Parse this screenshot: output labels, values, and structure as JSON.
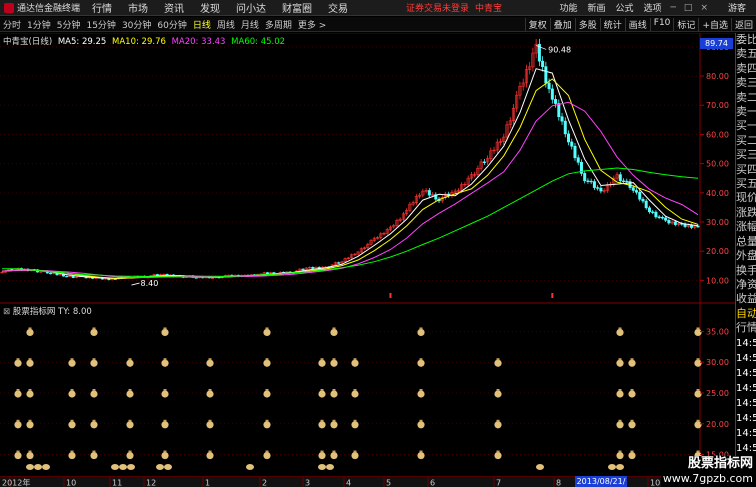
{
  "menubar": {
    "app_title": "通达信金融终端",
    "items": [
      "行情",
      "市场",
      "资讯",
      "发现",
      "问小达",
      "财富圈",
      "交易"
    ],
    "status": "证券交易未登录",
    "stock_name": "中青宝",
    "right_items": [
      "功能",
      "新画",
      "公式",
      "选项"
    ],
    "guest": "游客"
  },
  "toolbar": {
    "periods": [
      "分时",
      "1分钟",
      "5分钟",
      "15分钟",
      "30分钟",
      "60分钟",
      "日线",
      "周线",
      "月线",
      "多周期",
      "更多 >"
    ],
    "active_period": "日线",
    "tools": [
      "复权",
      "叠加",
      "多股",
      "统计",
      "画线",
      "F10",
      "标记",
      "+自选",
      "返回"
    ]
  },
  "main_legend": {
    "title": "中青宝(日线)",
    "ma5": "MA5: 29.25",
    "ma10": "MA10: 29.76",
    "ma20": "MA20: 33.43",
    "ma60": "MA60: 45.02",
    "colors": {
      "title": "#dddddd",
      "ma5": "#ffffff",
      "ma10": "#ffff00",
      "ma20": "#ff44ff",
      "ma60": "#00ff00"
    }
  },
  "sub_legend": {
    "title": "股票指标网",
    "ty": "TY: 8.00"
  },
  "price_tag": "89.74",
  "annotations": {
    "high": "90.48",
    "low": "8.40"
  },
  "main_y_ticks": [
    "90.00",
    "80.00",
    "70.00",
    "60.00",
    "50.00",
    "40.00",
    "30.00",
    "20.00",
    "10.00"
  ],
  "sub_y_ticks": [
    "35.00",
    "30.00",
    "25.00",
    "20.00",
    "15.00"
  ],
  "x_axis": {
    "labels": [
      "2012年",
      "10",
      "11",
      "12",
      "1",
      "2",
      "3",
      "4",
      "5",
      "6",
      "7",
      "8",
      "9",
      "10"
    ],
    "cursor_date": "2013/08/21/三"
  },
  "right_panel": {
    "items": [
      "委比",
      "卖五",
      "卖四",
      "卖三",
      "卖二",
      "卖一",
      "买一",
      "买二",
      "买三",
      "买四",
      "买五",
      "现价",
      "涨跌",
      "涨幅",
      "总量",
      "外盘",
      "换手",
      "净资",
      "收益"
    ],
    "auto": "自动",
    "quote": "行情",
    "times": [
      "14:5",
      "14:5",
      "14:5",
      "14:5",
      "14:5",
      "14:5",
      "14:5",
      "14:5"
    ]
  },
  "watermark": {
    "line1": "股票指标网",
    "line2": "www.7gpzb.com"
  },
  "chart_data": {
    "type": "candlestick",
    "title": "中青宝(日线)",
    "y_range": [
      5,
      92
    ],
    "y_ticks": [
      10,
      20,
      30,
      40,
      50,
      60,
      70,
      80,
      90
    ],
    "close": [
      13.2,
      13.8,
      13.5,
      12.4,
      11.6,
      11.0,
      10.8,
      10.5,
      11.2,
      11.5,
      11.8,
      11.5,
      11.0,
      11.2,
      11.4,
      11.6,
      12.2,
      12.5,
      13.0,
      14.2,
      14.5,
      16.5,
      20.0,
      24.0,
      28.0,
      34.0,
      41.0,
      38.0,
      40.0,
      46.0,
      52.0,
      60.0,
      75.0,
      90.0,
      72.0,
      58.0,
      45.0,
      40.0,
      46.0,
      41.0,
      34.0,
      30.0,
      29.0,
      28.5
    ],
    "ma60": [
      14,
      14,
      13.5,
      13,
      12.5,
      12,
      11.8,
      11.5,
      11.4,
      11.3,
      11.2,
      11.2,
      11.1,
      11.2,
      11.4,
      11.6,
      11.9,
      12.2,
      12.6,
      13.0,
      13.6,
      14.3,
      15.2,
      16.4,
      18.0,
      20.0,
      22.3,
      24.5,
      27.0,
      29.5,
      32.0,
      35.0,
      38.0,
      41.0,
      44.0,
      46.5,
      47.5,
      48.0,
      48.5,
      48.0,
      47.0,
      46.2,
      45.5,
      45.0
    ],
    "high_label": 90.48,
    "low_label": 8.4,
    "ma_values": {
      "MA5": 29.25,
      "MA10": 29.76,
      "MA20": 33.43,
      "MA60": 45.02
    },
    "signal_columns": [
      18,
      30,
      72,
      94,
      130,
      165,
      210,
      267,
      322,
      334,
      355,
      421,
      498,
      620,
      632,
      698
    ],
    "sub_y_range": [
      12,
      38
    ],
    "sub_levels": [
      8,
      15,
      20,
      25,
      30,
      35
    ]
  }
}
